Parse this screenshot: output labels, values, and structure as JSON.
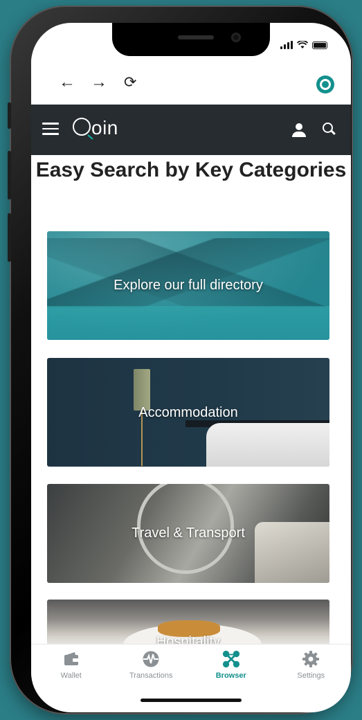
{
  "browser": {
    "back_icon": "arrow-left-icon",
    "forward_icon": "arrow-right-icon",
    "reload_icon": "reload-icon",
    "app_icon": "qoin-logo-icon"
  },
  "header": {
    "logo_text": "oin",
    "menu_icon": "hamburger-icon",
    "account_icon": "user-icon",
    "search_icon": "search-icon"
  },
  "page": {
    "title": "Easy Search by Key Categories"
  },
  "categories": [
    {
      "label": "Explore our full directory"
    },
    {
      "label": "Accommodation"
    },
    {
      "label": "Travel & Transport"
    },
    {
      "label": "Hospitality"
    }
  ],
  "tabbar": {
    "items": [
      {
        "label": "Wallet",
        "icon": "wallet-icon",
        "active": false
      },
      {
        "label": "Transactions",
        "icon": "transactions-icon",
        "active": false
      },
      {
        "label": "Browser",
        "icon": "browser-icon",
        "active": true
      },
      {
        "label": "Settings",
        "icon": "gear-icon",
        "active": false
      }
    ]
  },
  "colors": {
    "background": "#2b7d86",
    "header_bg": "#262c30",
    "accent": "#13908e",
    "inactive_tab": "#8b9094"
  }
}
